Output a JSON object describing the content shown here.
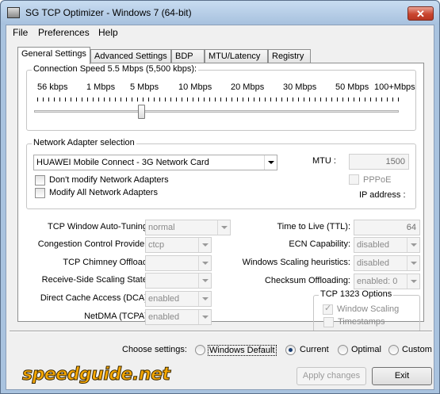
{
  "window": {
    "title": "SG TCP Optimizer - Windows 7 (64-bit)",
    "close_glyph": "✕"
  },
  "menu": [
    "File",
    "Preferences",
    "Help"
  ],
  "tabs": [
    "General Settings",
    "Advanced Settings",
    "BDP",
    "MTU/Latency",
    "Registry"
  ],
  "connection_speed": {
    "legend": "Connection Speed  5.5 Mbps (5,500 kbps):",
    "labels": [
      "56 kbps",
      "1 Mbps",
      "5 Mbps",
      "10 Mbps",
      "20 Mbps",
      "30 Mbps",
      "50 Mbps",
      "100+Mbps"
    ],
    "slider_value_mbps": 5.5
  },
  "adapter": {
    "legend": "Network Adapter selection",
    "selected": "HUAWEI Mobile Connect - 3G Network Card",
    "dont_modify": "Don't modify Network Adapters",
    "modify_all": "Modify All Network Adapters",
    "mtu_label": "MTU :",
    "mtu_value": "1500",
    "pppoe": "PPPoE",
    "ip_label": "IP address :"
  },
  "settings_left": [
    {
      "label": "TCP Window Auto-Tuning:",
      "value": "normal"
    },
    {
      "label": "Congestion Control Provider:",
      "value": "ctcp"
    },
    {
      "label": "TCP Chimney Offload:",
      "value": ""
    },
    {
      "label": "Receive-Side Scaling State:",
      "value": ""
    },
    {
      "label": "Direct Cache Access (DCA):",
      "value": "enabled"
    },
    {
      "label": "NetDMA (TCPA):",
      "value": "enabled"
    }
  ],
  "settings_right": [
    {
      "label": "Time to Live (TTL):",
      "value": "64"
    },
    {
      "label": "ECN Capability:",
      "value": "disabled"
    },
    {
      "label": "Windows Scaling heuristics:",
      "value": "disabled"
    },
    {
      "label": "Checksum Offloading:",
      "value": "enabled: 0"
    }
  ],
  "tcp1323": {
    "legend": "TCP 1323 Options",
    "window_scaling": "Window Scaling",
    "timestamps": "Timestamps"
  },
  "choose": {
    "label": "Choose settings:",
    "options": [
      "Windows Default",
      "Current",
      "Optimal",
      "Custom"
    ],
    "selected": "Current"
  },
  "buttons": {
    "apply": "Apply changes",
    "exit": "Exit"
  },
  "logo_text": "speedguide.net"
}
